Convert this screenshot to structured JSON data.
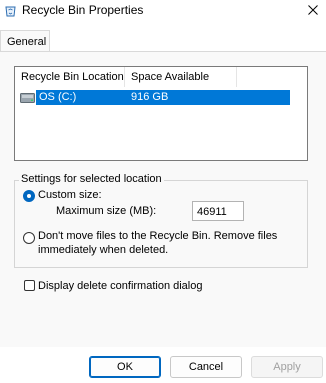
{
  "window": {
    "title": "Recycle Bin Properties",
    "icon": "recycle-bin-icon",
    "close_icon": "close-icon"
  },
  "tabs": [
    {
      "label": "General",
      "selected": true
    }
  ],
  "listview": {
    "columns": [
      "Recycle Bin Location",
      "Space Available"
    ],
    "rows": [
      {
        "location": "OS (C:)",
        "space": "916 GB",
        "icon": "drive-icon",
        "selected": true
      }
    ]
  },
  "settings": {
    "group_title": "Settings for selected location",
    "custom_size_label": "Custom size:",
    "custom_size_selected": true,
    "max_size_label": "Maximum size (MB):",
    "max_size_value": "46911",
    "dont_move_label_line1": "Don't move files to the Recycle Bin. Remove files",
    "dont_move_label_line2": "immediately when deleted.",
    "dont_move_selected": false
  },
  "confirm_dialog": {
    "label": "Display delete confirmation dialog",
    "checked": false
  },
  "buttons": {
    "ok": "OK",
    "cancel": "Cancel",
    "apply": "Apply"
  },
  "colors": {
    "accent": "#0078d7",
    "primary_border": "#0067c0",
    "disabled_text": "#a0a0a0"
  }
}
